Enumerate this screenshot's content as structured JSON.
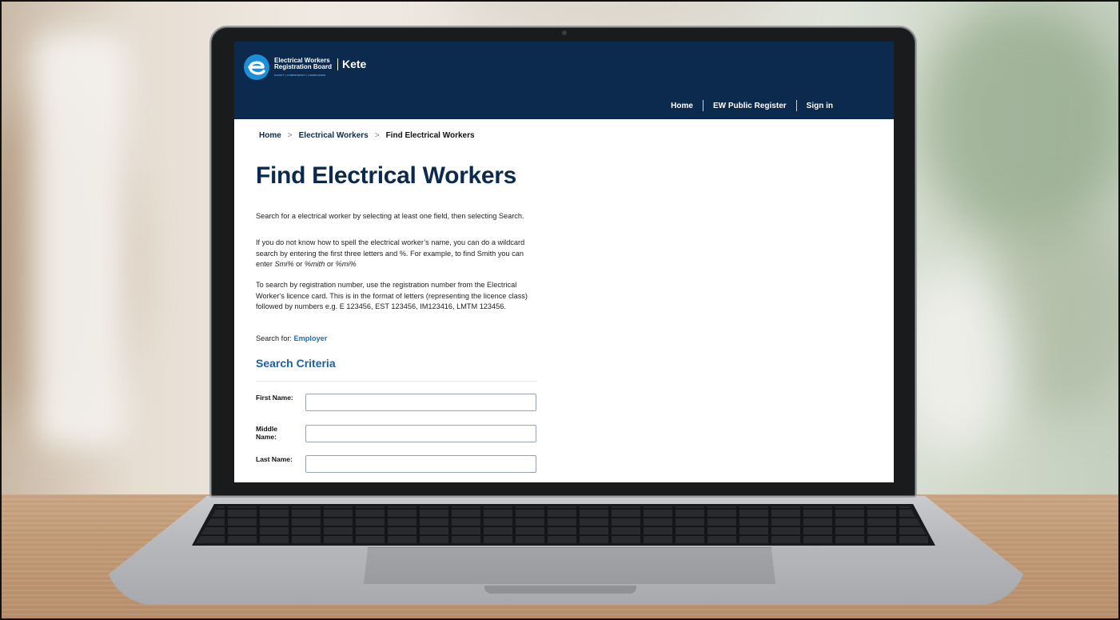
{
  "header": {
    "org_name": "Electrical Workers Registration Board",
    "org_tagline": "SAFETY | COMPETENCY | COMPLIANCE",
    "app_name": "Kete",
    "nav": [
      "Home",
      "EW Public Register",
      "Sign in"
    ]
  },
  "breadcrumb": {
    "items": [
      "Home",
      "Electrical Workers"
    ],
    "separator": ">",
    "current": "Find Electrical Workers"
  },
  "page": {
    "title": "Find Electrical Workers",
    "intro": "Search for a electrical worker by selecting at least one field, then selecting Search.",
    "wildcard": {
      "text": "If you do not know how to spell the electrical worker’s name, you can do a wildcard search by entering the first three letters and %. For example, to find Smith you can enter",
      "example1": "Smi%",
      "or1": "or",
      "example2": "%mith",
      "or2": "or",
      "example3": "%mi%"
    },
    "registration_info": "To search by registration number, use the registration number from the Electrical Worker's licence card. This is in the format of letters (representing the licence class) followed by numbers e.g. E 123456, EST 123456, IM123416, LMTM 123456.",
    "search_for_label": "Search for:",
    "search_for_link": "Employer"
  },
  "search_criteria": {
    "title": "Search Criteria",
    "fields": [
      {
        "label": "First Name:",
        "value": ""
      },
      {
        "label": "Middle Name:",
        "value": ""
      },
      {
        "label": "Last Name:",
        "value": ""
      }
    ]
  },
  "colors": {
    "header_bg": "#0b2a4d",
    "title": "#0b2a4d",
    "link": "#1f6fb0",
    "section_title": "#1f5fa0"
  }
}
